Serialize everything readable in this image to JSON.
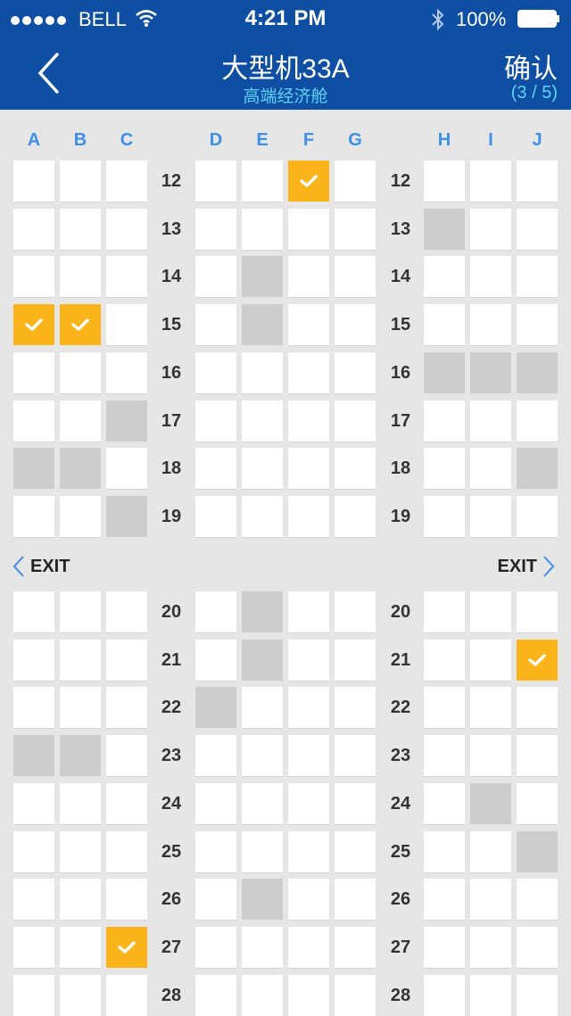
{
  "status_bar": {
    "carrier": "BELL",
    "time": "4:21 PM",
    "battery": "100%"
  },
  "nav": {
    "title": "大型机33A",
    "subtitle": "高端经济舱",
    "confirm": "确认",
    "progress": "(3 / 5)"
  },
  "columns": [
    "A",
    "B",
    "C",
    "D",
    "E",
    "F",
    "G",
    "H",
    "I",
    "J"
  ],
  "exit": {
    "left": "EXIT",
    "right": "EXIT"
  },
  "rows_before_exit": [
    "12",
    "13",
    "14",
    "15",
    "16",
    "17",
    "18",
    "19"
  ],
  "rows_after_exit": [
    "20",
    "21",
    "22",
    "23",
    "24",
    "25",
    "26",
    "27",
    "28"
  ],
  "seats": {
    "taken": [
      "13H",
      "14E",
      "15E",
      "16H",
      "16I",
      "16J",
      "17C",
      "18A",
      "18B",
      "18J",
      "19C",
      "20E",
      "21E",
      "22D",
      "23A",
      "23B",
      "24I",
      "25J",
      "26E"
    ],
    "selected": [
      "12F",
      "15A",
      "15B",
      "21J",
      "27C"
    ]
  },
  "colors": {
    "header": "#0e4fa3",
    "accent_text": "#5fd3f7",
    "column_letter": "#3d8ee7",
    "selected": "#fbb51a",
    "taken": "#cdcdcd",
    "background": "#e6e6e6"
  },
  "icons": {
    "back": "chevron-left-icon",
    "check": "checkmark-icon",
    "wifi": "wifi-icon",
    "bluetooth": "bluetooth-icon",
    "battery": "battery-icon"
  }
}
